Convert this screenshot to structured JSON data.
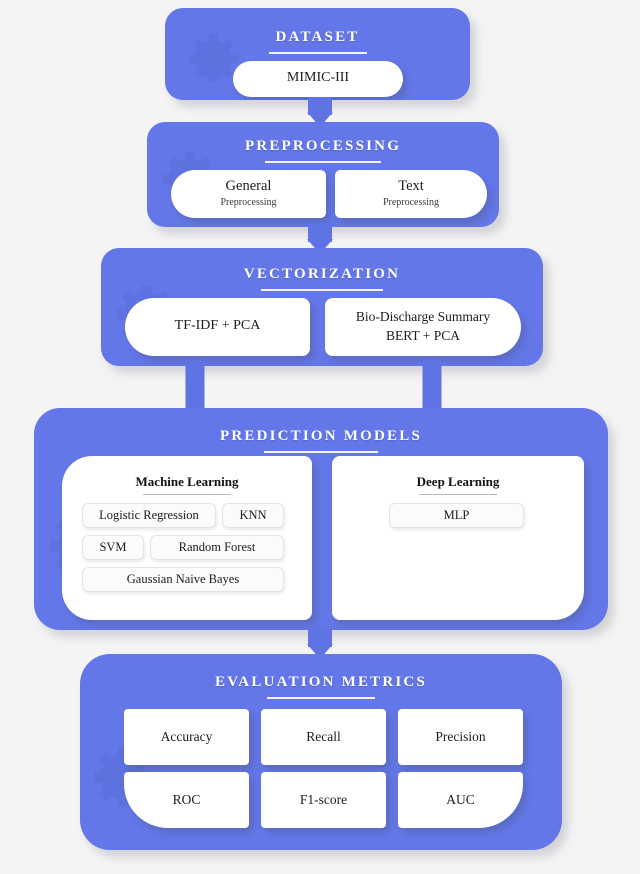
{
  "diagram": {
    "title": "Machine learning pipeline flowchart",
    "accent_color": "#6377e8",
    "background_color": "#f4f4f5",
    "card_color": "#ffffff"
  },
  "stages": [
    {
      "id": "dataset",
      "title": "DATASET",
      "items": [
        {
          "label": "MIMIC-III",
          "sub": ""
        }
      ]
    },
    {
      "id": "preprocessing",
      "title": "PREPROCESSING",
      "items": [
        {
          "label": "General",
          "sub": "Preprocessing"
        },
        {
          "label": "Text",
          "sub": "Preprocessing"
        }
      ]
    },
    {
      "id": "vectorization",
      "title": "VECTORIZATION",
      "items": [
        {
          "label": "TF-IDF + PCA",
          "sub": ""
        },
        {
          "label": "Bio-Discharge Summary",
          "sub": "BERT + PCA"
        }
      ]
    },
    {
      "id": "prediction_models",
      "title": "PREDICTION MODELS",
      "groups": [
        {
          "heading": "Machine Learning",
          "models": [
            "Logistic Regression",
            "KNN",
            "SVM",
            "Random Forest",
            "Gaussian Naive Bayes"
          ]
        },
        {
          "heading": "Deep Learning",
          "models": [
            "MLP"
          ]
        }
      ]
    },
    {
      "id": "evaluation_metrics",
      "title": "EVALUATION METRICS",
      "metrics": [
        "Accuracy",
        "Recall",
        "Precision",
        "ROC",
        "F1-score",
        "AUC"
      ]
    }
  ]
}
